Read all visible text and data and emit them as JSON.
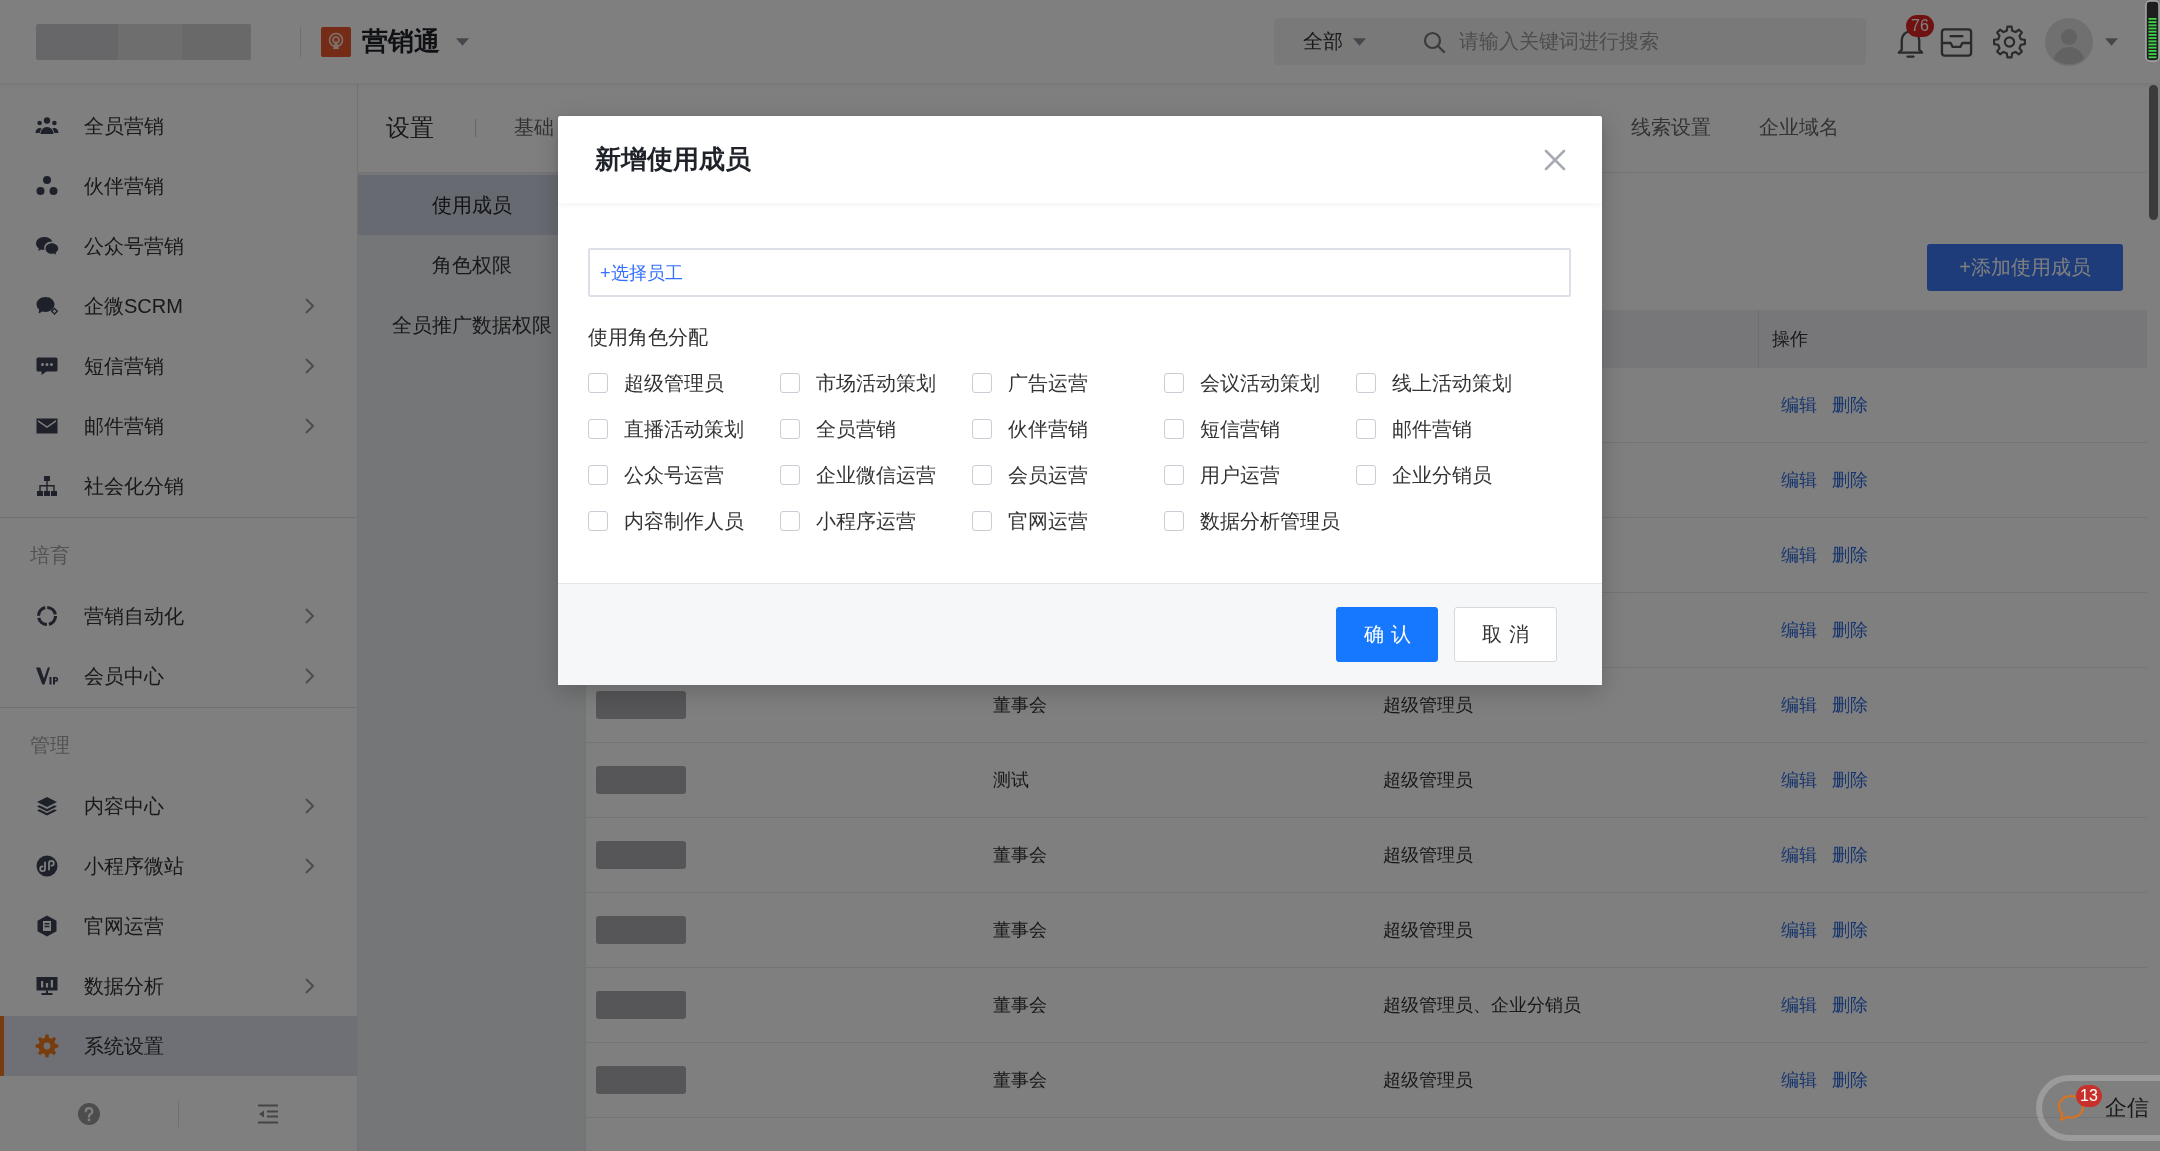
{
  "top_bar": {
    "product_name": "营销通",
    "search": {
      "scope": "全部",
      "placeholder": "请输入关键词进行搜索"
    },
    "notification_count": "76"
  },
  "sidebar": {
    "sections": [
      {
        "items": [
          {
            "label": "全员营销",
            "has_submenu": false,
            "selected": false
          },
          {
            "label": "伙伴营销",
            "has_submenu": false,
            "selected": false
          },
          {
            "label": "公众号营销",
            "has_submenu": false,
            "selected": false
          },
          {
            "label": "企微SCRM",
            "has_submenu": true,
            "selected": false
          },
          {
            "label": "短信营销",
            "has_submenu": true,
            "selected": false
          },
          {
            "label": "邮件营销",
            "has_submenu": true,
            "selected": false
          },
          {
            "label": "社会化分销",
            "has_submenu": false,
            "selected": false
          }
        ]
      },
      {
        "header": "培育",
        "items": [
          {
            "label": "营销自动化",
            "has_submenu": true,
            "selected": false
          },
          {
            "label": "会员中心",
            "has_submenu": true,
            "selected": false
          }
        ]
      },
      {
        "header": "管理",
        "items": [
          {
            "label": "内容中心",
            "has_submenu": true,
            "selected": false
          },
          {
            "label": "小程序微站",
            "has_submenu": true,
            "selected": false
          },
          {
            "label": "官网运营",
            "has_submenu": false,
            "selected": false
          },
          {
            "label": "数据分析",
            "has_submenu": true,
            "selected": false
          },
          {
            "label": "系统设置",
            "has_submenu": false,
            "selected": true
          }
        ]
      }
    ]
  },
  "settings_header": {
    "title": "设置",
    "tabs": [
      {
        "label": "基础",
        "selected": false
      },
      {
        "label": "线索设置",
        "selected": false
      },
      {
        "label": "企业域名",
        "selected": false
      }
    ]
  },
  "settings_nav": [
    {
      "label": "使用成员",
      "selected": true
    },
    {
      "label": "角色权限",
      "selected": false
    },
    {
      "label": "全员推广数据权限",
      "selected": false
    }
  ],
  "add_member_button": "+添加使用成员",
  "table": {
    "action_header": "操作",
    "rows": [
      {
        "redacted_name": false,
        "actions": [
          "编辑",
          "删除"
        ]
      },
      {
        "redacted_name": false,
        "actions": [
          "编辑",
          "删除"
        ]
      },
      {
        "redacted_name": false,
        "actions": [
          "编辑",
          "删除"
        ]
      },
      {
        "redacted_name": false,
        "actions": [
          "编辑",
          "删除"
        ]
      },
      {
        "redacted_name": true,
        "column_2": "董事会",
        "column_3": "超级管理员",
        "actions": [
          "编辑",
          "删除"
        ]
      },
      {
        "redacted_name": true,
        "column_2": "测试",
        "column_3": "超级管理员",
        "actions": [
          "编辑",
          "删除"
        ]
      },
      {
        "redacted_name": true,
        "column_2": "董事会",
        "column_3": "超级管理员",
        "actions": [
          "编辑",
          "删除"
        ]
      },
      {
        "redacted_name": true,
        "column_2": "董事会",
        "column_3": "超级管理员",
        "actions": [
          "编辑",
          "删除"
        ]
      },
      {
        "redacted_name": true,
        "column_2": "董事会",
        "column_3": "超级管理员、企业分销员",
        "actions": [
          "编辑",
          "删除"
        ]
      },
      {
        "redacted_name": true,
        "column_2": "董事会",
        "column_3": "超级管理员",
        "actions": [
          "编辑",
          "删除"
        ]
      }
    ]
  },
  "chat_widget": {
    "label": "企信",
    "badge": "13"
  },
  "dialog": {
    "title": "新增使用成员",
    "employee_picker": "+选择员工",
    "roles_label": "使用角色分配",
    "roles": [
      {
        "label": "超级管理员",
        "checked": false
      },
      {
        "label": "市场活动策划",
        "checked": false
      },
      {
        "label": "广告运营",
        "checked": false
      },
      {
        "label": "会议活动策划",
        "checked": false
      },
      {
        "label": "线上活动策划",
        "checked": false
      },
      {
        "label": "直播活动策划",
        "checked": false
      },
      {
        "label": "全员营销",
        "checked": false
      },
      {
        "label": "伙伴营销",
        "checked": false
      },
      {
        "label": "短信营销",
        "checked": false
      },
      {
        "label": "邮件营销",
        "checked": false
      },
      {
        "label": "公众号运营",
        "checked": false
      },
      {
        "label": "企业微信运营",
        "checked": false
      },
      {
        "label": "会员运营",
        "checked": false
      },
      {
        "label": "用户运营",
        "checked": false
      },
      {
        "label": "企业分销员",
        "checked": false
      },
      {
        "label": "内容制作人员",
        "checked": false
      },
      {
        "label": "小程序运营",
        "checked": false
      },
      {
        "label": "官网运营",
        "checked": false
      },
      {
        "label": "数据分析管理员",
        "checked": false
      }
    ],
    "buttons": [
      {
        "label": "确认",
        "kind": "primary"
      },
      {
        "label": "取消",
        "kind": "secondary"
      }
    ]
  }
}
